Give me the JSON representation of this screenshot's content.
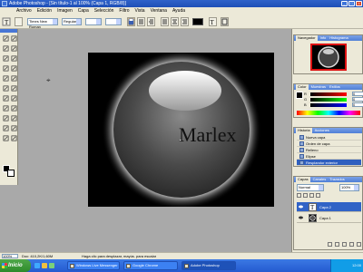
{
  "window": {
    "title": "Adobe Photoshop - [Sin título-1 al 100% (Capa 1, RGB/8)]",
    "buttons": [
      "_",
      "□",
      "×"
    ]
  },
  "menu": {
    "items": [
      "Archivo",
      "Edición",
      "Imagen",
      "Capa",
      "Selección",
      "Filtro",
      "Vista",
      "Ventana",
      "Ayuda"
    ]
  },
  "options": {
    "font_family": "Times New Roman",
    "font_size": "Regular",
    "text_color": "#000000"
  },
  "document": {
    "text": "Marlex",
    "background": "#000000"
  },
  "panels": {
    "navigator": {
      "tabs": [
        "Navegador",
        "Info",
        "Histograma"
      ]
    },
    "color": {
      "tabs": [
        "Color",
        "Muestras",
        "Estilos"
      ],
      "rows": [
        {
          "label": "R",
          "value": "0"
        },
        {
          "label": "G",
          "value": "0"
        },
        {
          "label": "B",
          "value": "0"
        }
      ]
    },
    "history": {
      "tabs": [
        "Historia",
        "Acciones"
      ],
      "items": [
        "Nueva capa",
        "Orden de capa",
        "Relleno",
        "Elipse",
        "Resplandor exterior"
      ]
    },
    "layers": {
      "tabs": [
        "Capas",
        "Canales",
        "Trazados"
      ],
      "mode": "Normal",
      "opacity": "100%",
      "items": [
        {
          "name": "Capa 2",
          "type": "text"
        },
        {
          "name": "Capa 1",
          "type": "image"
        }
      ]
    }
  },
  "status": {
    "zoom": "100%",
    "doc": "Doc: 410,2K/1,60M",
    "hint": "Haga clic para desplazar, mayús. para escalar"
  },
  "taskbar": {
    "start": "Inicio",
    "tasks": [
      "Windows Live Messenger",
      "Google Chrome",
      "Adobe Photoshop"
    ],
    "tray_time": "12:00"
  }
}
